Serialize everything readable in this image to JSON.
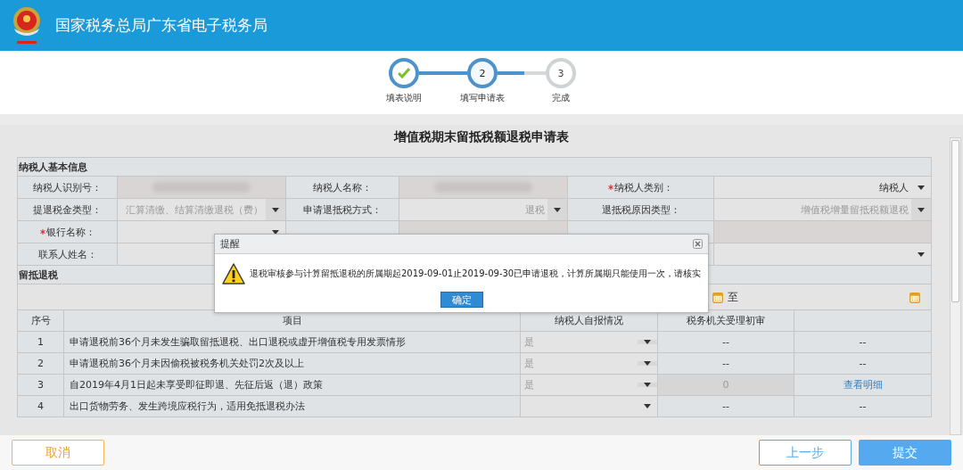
{
  "header": {
    "title": "国家税务总局广东省电子税务局"
  },
  "steps": [
    {
      "label": "填表说明",
      "completed": true,
      "selected": false
    },
    {
      "label": "填写申请表",
      "completed": false,
      "selected": true,
      "number": "2"
    },
    {
      "label": "完成",
      "completed": false,
      "selected": false,
      "number": "3"
    }
  ],
  "form": {
    "title": "增值税期末留抵税额退税申请表",
    "basic_info": {
      "heading": "纳税人基本信息",
      "fields": [
        {
          "label": "纳税人识别号：",
          "required": false,
          "kind": "redacted"
        },
        {
          "label": "纳税人名称：",
          "required": false,
          "kind": "redacted"
        },
        {
          "label": "纳税人类别：",
          "required": true,
          "kind": "select",
          "value": "纳税人",
          "disabled": false
        },
        {
          "label": "提退税金类型：",
          "required": false,
          "kind": "select",
          "value": "汇算清缴、结算清缴退税（费）",
          "disabled": true
        },
        {
          "label": "申请退抵税方式：",
          "required": false,
          "kind": "select",
          "value": "退税",
          "disabled": true
        },
        {
          "label": "退抵税原因类型：",
          "required": false,
          "kind": "select",
          "value": "增值税增量留抵税额退税",
          "disabled": true
        },
        {
          "label": "银行名称：",
          "required": true,
          "kind": "select",
          "disabled": false
        },
        {
          "kind": "readonly"
        },
        {
          "kind": "readonly"
        },
        {
          "label": "联系人姓名：",
          "required": false,
          "kind": "text"
        },
        {
          "kind": "blank"
        },
        {
          "kind": "select",
          "disabled": false
        }
      ]
    },
    "refund": {
      "heading": "留抵退税",
      "date_separator": "至",
      "columns": [
        "序号",
        "项目",
        "纳税人自报情况",
        "税务机关受理初审",
        ""
      ],
      "rows": [
        {
          "no": "1",
          "item": "申请退税前36个月未发生骗取留抵退税、出口退税或虚开增值税专用发票情形",
          "self": {
            "value": "是",
            "disabled": true
          },
          "review": {
            "kind": "text",
            "value": "--"
          },
          "detail": {
            "kind": "text",
            "value": "--"
          }
        },
        {
          "no": "2",
          "item": "申请退税前36个月未因偷税被税务机关处罚2次及以上",
          "self": {
            "value": "是",
            "disabled": true
          },
          "review": {
            "kind": "text",
            "value": "--"
          },
          "detail": {
            "kind": "text",
            "value": "--"
          }
        },
        {
          "no": "3",
          "item": "自2019年4月1日起未享受即征即退、先征后返（退）政策",
          "self": {
            "value": "是",
            "disabled": true
          },
          "review": {
            "kind": "readonly",
            "value": "0"
          },
          "detail": {
            "kind": "link",
            "value": "查看明细"
          }
        },
        {
          "no": "4",
          "item": "出口货物劳务、发生跨境应税行为，适用免抵退税办法",
          "self": {
            "disabled": false
          },
          "review": {
            "kind": "text",
            "value": "--"
          },
          "detail": {
            "kind": "text",
            "value": "--"
          }
        }
      ]
    }
  },
  "footer": {
    "buttons": [
      {
        "label": "取消",
        "kind": "cancel"
      },
      {
        "label": "上一步",
        "kind": "secondary"
      },
      {
        "label": "提交",
        "kind": "primary"
      }
    ]
  },
  "dialog": {
    "title": "提醒",
    "message": "退税审核参与计算留抵退税的所属期起2019-09-01止2019-09-30已申请退税，计算所属期只能使用一次，请核实",
    "button": "确定"
  }
}
